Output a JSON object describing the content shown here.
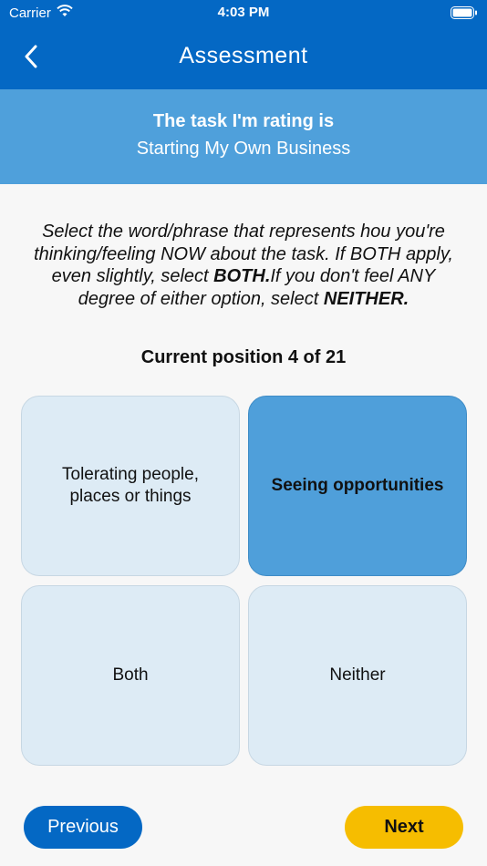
{
  "status_bar": {
    "carrier": "Carrier",
    "time": "4:03 PM"
  },
  "nav": {
    "title": "Assessment"
  },
  "task": {
    "heading": "The task I'm rating is",
    "name": "Starting My Own Business"
  },
  "instructions": {
    "line1": "Select the word/phrase that represents hou you're thinking/feeling NOW about the task. If BOTH apply, even slightly, select ",
    "both": "BOTH.",
    "line2": "If you don't feel ANY degree of either option, select ",
    "neither": "NEITHER."
  },
  "position": {
    "text": "Current position 4  of 21"
  },
  "options": [
    {
      "label": "Tolerating people, places or things",
      "selected": false
    },
    {
      "label": "Seeing opportunities",
      "selected": true
    },
    {
      "label": "Both",
      "selected": false
    },
    {
      "label": "Neither",
      "selected": false
    }
  ],
  "buttons": {
    "previous": "Previous",
    "next": "Next"
  },
  "colors": {
    "primary": "#0468c4",
    "banner": "#4fa0db",
    "selected": "#4f9fda",
    "option": "#ddebf5",
    "next": "#f6bd00"
  }
}
